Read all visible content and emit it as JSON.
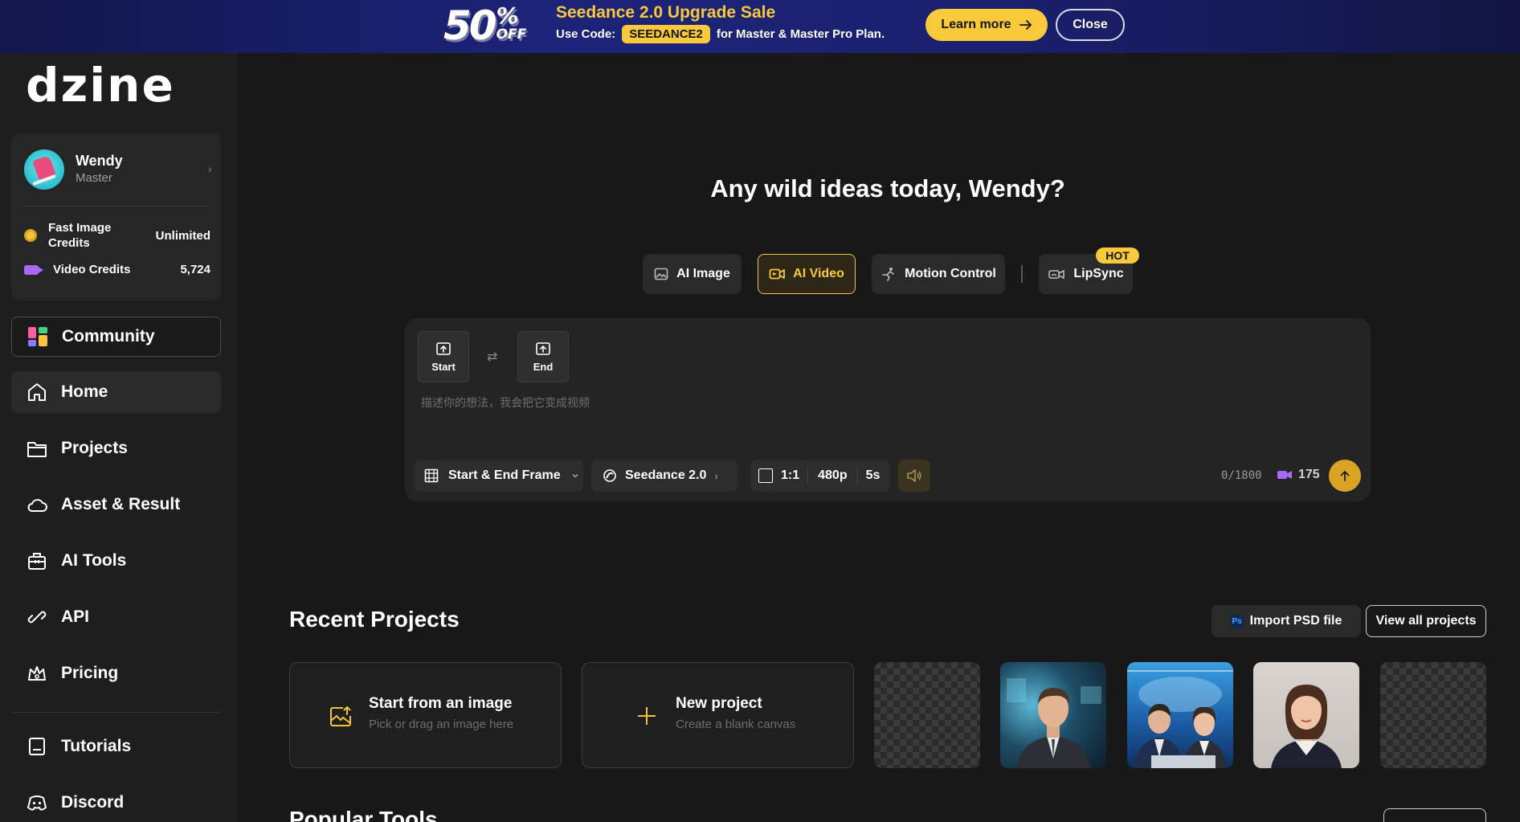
{
  "banner": {
    "badge_number": "50",
    "badge_percent": "%",
    "badge_off": "OFF",
    "title": "Seedance 2.0 Upgrade Sale",
    "use_code_label": "Use Code:",
    "code": "SEEDANCE2",
    "plan_text": "for Master & Master Pro Plan.",
    "learn_more_label": "Learn more",
    "close_label": "Close",
    "colors": {
      "accent": "#f8c93a",
      "background": "#1c2378"
    }
  },
  "sidebar": {
    "logo": "dzine",
    "user": {
      "name": "Wendy",
      "plan": "Master"
    },
    "credits": [
      {
        "label": "Fast Image Credits",
        "value": "Unlimited",
        "icon": "coin-icon"
      },
      {
        "label": "Video Credits",
        "value": "5,724",
        "icon": "video-camera-icon"
      }
    ],
    "community_label": "Community",
    "nav": [
      {
        "label": "Home",
        "icon": "home-icon",
        "active": true
      },
      {
        "label": "Projects",
        "icon": "folder-icon"
      },
      {
        "label": "Asset & Result",
        "icon": "cloud-icon"
      },
      {
        "label": "AI Tools",
        "icon": "toolbox-icon"
      },
      {
        "label": "API",
        "icon": "api-link-icon"
      },
      {
        "label": "Pricing",
        "icon": "crown-icon"
      }
    ],
    "nav_secondary": [
      {
        "label": "Tutorials",
        "icon": "tutorials-icon"
      },
      {
        "label": "Discord",
        "icon": "discord-icon"
      }
    ]
  },
  "main": {
    "greeting": "Any wild ideas today, Wendy?",
    "modes": [
      {
        "label": "AI Image",
        "icon": "image-icon"
      },
      {
        "label": "AI Video",
        "icon": "video-icon",
        "active": true
      },
      {
        "label": "Motion Control",
        "icon": "motion-icon"
      },
      {
        "label": "LipSync",
        "icon": "lipsync-icon",
        "badge": "HOT"
      }
    ],
    "prompt": {
      "start_label": "Start",
      "end_label": "End",
      "placeholder": "描述你的想法，我会把它变成视频",
      "frame_mode": "Start & End Frame",
      "model": "Seedance 2.0",
      "aspect_ratio": "1:1",
      "resolution": "480p",
      "duration": "5s",
      "char_count": "0/1800",
      "cost": "175"
    },
    "recent": {
      "title": "Recent Projects",
      "import_label": "Import PSD file",
      "ps_icon_text": "Ps",
      "view_all_label": "View all projects",
      "start_image": {
        "title": "Start from an image",
        "subtitle": "Pick or drag an image here"
      },
      "new_project": {
        "title": "New project",
        "subtitle": "Create a blank canvas"
      }
    },
    "popular_title": "Popular Tools"
  }
}
